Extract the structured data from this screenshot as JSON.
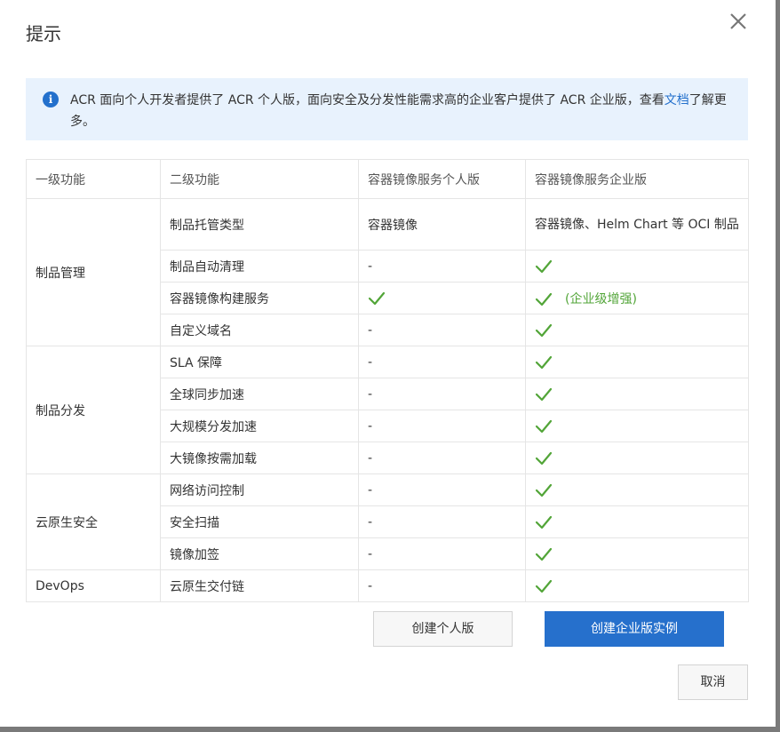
{
  "dialog": {
    "title": "提示",
    "notice": {
      "text": "ACR 面向个人开发者提供了 ACR 个人版，面向安全及分发性能需求高的企业客户提供了 ACR 企业版，查看",
      "link_text": "文档",
      "suffix": "了解更多。"
    },
    "table": {
      "headers": [
        "一级功能",
        "二级功能",
        "容器镜像服务个人版",
        "容器镜像服务企业版"
      ],
      "groups": [
        {
          "name": "制品管理",
          "rows": [
            {
              "feature": "制品托管类型",
              "personal": "容器镜像",
              "enterprise": "容器镜像、Helm Chart 等 OCI 制品"
            },
            {
              "feature": "制品自动清理",
              "personal": "-",
              "enterprise": "check"
            },
            {
              "feature": "容器镜像构建服务",
              "personal": "check",
              "enterprise": "check",
              "enterprise_note": "(企业级增强)"
            },
            {
              "feature": "自定义域名",
              "personal": "-",
              "enterprise": "check"
            }
          ]
        },
        {
          "name": "制品分发",
          "rows": [
            {
              "feature": "SLA 保障",
              "personal": "-",
              "enterprise": "check"
            },
            {
              "feature": "全球同步加速",
              "personal": "-",
              "enterprise": "check"
            },
            {
              "feature": "大规模分发加速",
              "personal": "-",
              "enterprise": "check"
            },
            {
              "feature": "大镜像按需加载",
              "personal": "-",
              "enterprise": "check"
            }
          ]
        },
        {
          "name": "云原生安全",
          "rows": [
            {
              "feature": "网络访问控制",
              "personal": "-",
              "enterprise": "check"
            },
            {
              "feature": "安全扫描",
              "personal": "-",
              "enterprise": "check"
            },
            {
              "feature": "镜像加签",
              "personal": "-",
              "enterprise": "check"
            }
          ]
        },
        {
          "name": "DevOps",
          "rows": [
            {
              "feature": "云原生交付链",
              "personal": "-",
              "enterprise": "check"
            }
          ]
        }
      ]
    },
    "buttons": {
      "create_personal": "创建个人版",
      "create_enterprise": "创建企业版实例",
      "cancel": "取消"
    }
  },
  "colors": {
    "accent": "#2670cc",
    "check_green": "#52a538",
    "notice_bg": "#e8f2fd"
  }
}
